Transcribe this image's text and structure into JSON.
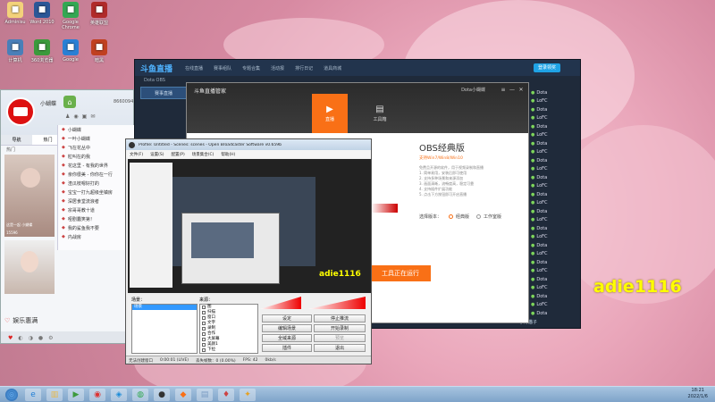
{
  "desktop": {
    "icons": [
      {
        "label": "Adminisu",
        "name": "admin-folder-icon",
        "color": "#f3d27a"
      },
      {
        "label": "Word 2010",
        "name": "word-icon",
        "color": "#2b5797"
      },
      {
        "label": "Google Chrome",
        "name": "chrome-icon",
        "color": "#34a853"
      },
      {
        "label": "英雄联盟",
        "name": "lol-icon",
        "color": "#b02a2a"
      },
      {
        "label": "计算机",
        "name": "computer-icon",
        "color": "#4a7fb8"
      },
      {
        "label": "360浏览器",
        "name": "browser-icon",
        "color": "#3c9a3c"
      },
      {
        "label": "Google",
        "name": "google-icon",
        "color": "#2a7fd4"
      },
      {
        "label": "暗黑",
        "name": "game-icon",
        "color": "#c04020"
      }
    ]
  },
  "qq": {
    "nickname": "小蝴蝶",
    "room_id": "8660094",
    "tabs": [
      "导航",
      "热门"
    ],
    "sub_tab": "热门",
    "card1_name": "这是一起 小蝴蝶",
    "card1_stats": "15596",
    "card2_stats": "14336",
    "footer_text": "娱乐惠满",
    "rows": [
      "小蝴蝶",
      "一叶小蝴蝶",
      "飞在花丛中",
      "粒叫在的我",
      "花这里 - 有我的世界",
      "亲你很美 - 你你在一行",
      "渣瓜枝嗯好打的",
      "宝宝一打九超级坐镇房",
      "深居食堂流浪者",
      "宗哥哥教十道",
      "哑剧蠢笑第！",
      "我的鲨鱼我不要",
      "内战房"
    ]
  },
  "douyu": {
    "header_title": "斗鱼直播",
    "nav": [
      "在线直播",
      "赛事组队",
      "专题合集",
      "活动报",
      "排行日记",
      "道具商城"
    ],
    "login_btn": "登录领奖",
    "tag": "Dota OBS",
    "sub_title": "赛事直播",
    "rooms": [
      "Dota",
      "LoFC",
      "Dota",
      "LoFC",
      "Dota",
      "LoFC",
      "Dota",
      "LoFC",
      "Dota",
      "LoFC",
      "Dota",
      "LoFC",
      "Dota",
      "LoFC",
      "Dota",
      "LoFC",
      "Dota",
      "LoFC",
      "Dota",
      "LoFC",
      "Dota",
      "LoFC",
      "Dota",
      "LoFC",
      "Dota",
      "LoFC",
      "Dota"
    ],
    "bottom_label": "小月猫子"
  },
  "tool": {
    "title": "斗鱼直播管家",
    "user": "Dota小蝴蝶",
    "tab_live": "直播",
    "tab_tools": "工具箱",
    "heading": "OBS经典版",
    "subheading": "支持Win7/Win8/Win10",
    "desc": [
      "免费且开源的软件，用于视频录制和直播",
      "1. 简单易用，安装后即可使用",
      "2. 支持多种场景和来源添加",
      "3. 画面清晰，流畅度高，稳定可靠",
      "4. 支持插件扩展功能",
      "5. 点击下方按钮即可开启直播"
    ],
    "version_label": "选择版本：",
    "option1": "经典版",
    "option2": "工作室版",
    "start_btn": "工具正在运行"
  },
  "obs": {
    "title": "Profile: Untitled - Scenes: scenes - Open Broadcaster Software v0.659b",
    "menu": [
      "文件(F)",
      "设置(S)",
      "配置(P)",
      "场景集合(C)",
      "帮助(H)"
    ],
    "scenes_label": "场景：",
    "sources_label": "来源：",
    "scenes": [
      "场景"
    ],
    "sources": [
      "图",
      "扫描",
      "窗口",
      "文字",
      "录制",
      "合作",
      "大屏幕",
      "美颜1",
      "下拉"
    ],
    "buttons": {
      "settings": "设定",
      "stop_stream": "停止推流",
      "edit_scene": "编辑场景",
      "start_rec": "开始录制",
      "global_sources": "全域来源",
      "plugins": "插件",
      "exit": "退出",
      "preview": "预览"
    },
    "status_left": "无法创建窗口",
    "status_time": "0:00:01 (LIVE)",
    "status_dropped": "丢失帧数：0 (0.00%)",
    "status_fps": "FPS: 42",
    "status_kbps": "0kb/s",
    "watermark": "adie1116"
  },
  "overlay": {
    "big_text": "adie1116"
  },
  "clock": {
    "time": "18:21",
    "date": "2022/1/6"
  },
  "taskbar": {
    "items": [
      "start-orb-icon",
      "ie-icon",
      "folder-icon",
      "media-icon",
      "netease-icon",
      "qq-icon",
      "chrome-icon",
      "obs-icon",
      "douyu-icon",
      "explorer-icon",
      "game-icon",
      "tool-icon"
    ]
  },
  "colors": {
    "douyu_bg": "#1f2a3a",
    "douyu_nav": "#22344d",
    "accent_orange": "#f97016",
    "overlay_yellow": "#ffff00",
    "obs_bg": "#eeeeee"
  }
}
